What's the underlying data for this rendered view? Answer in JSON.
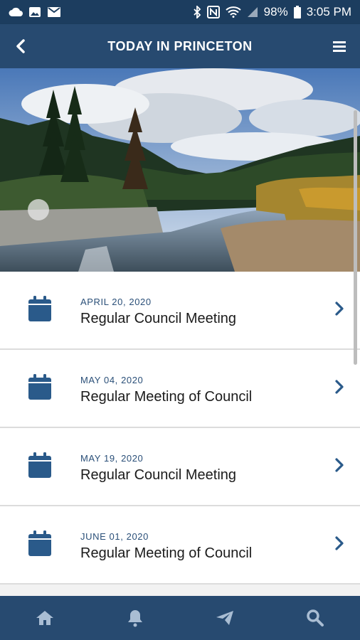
{
  "status_bar": {
    "battery": "98%",
    "time": "3:05 PM",
    "icons": [
      "cloud-icon",
      "image-icon",
      "mail-icon",
      "bluetooth-icon",
      "nfc-icon",
      "wifi-icon",
      "signal-icon",
      "battery-icon"
    ]
  },
  "header": {
    "title": "TODAY IN PRINCETON",
    "back_icon": "chevron-left-icon",
    "menu_icon": "hamburger-menu-icon"
  },
  "events": [
    {
      "date": "APRIL 20, 2020",
      "title": "Regular Council Meeting"
    },
    {
      "date": "MAY 04, 2020",
      "title": "Regular Meeting of Council"
    },
    {
      "date": "MAY 19, 2020",
      "title": "Regular Council Meeting"
    },
    {
      "date": "JUNE 01, 2020",
      "title": "Regular Meeting of Council"
    }
  ],
  "bottom_nav": [
    "home-icon",
    "bell-icon",
    "send-icon",
    "search-icon"
  ],
  "colors": {
    "statusbar_bg": "#1c3d5f",
    "appbar_bg": "#274a70",
    "accent": "#2a5a8a",
    "list_bg": "#ffffff"
  }
}
